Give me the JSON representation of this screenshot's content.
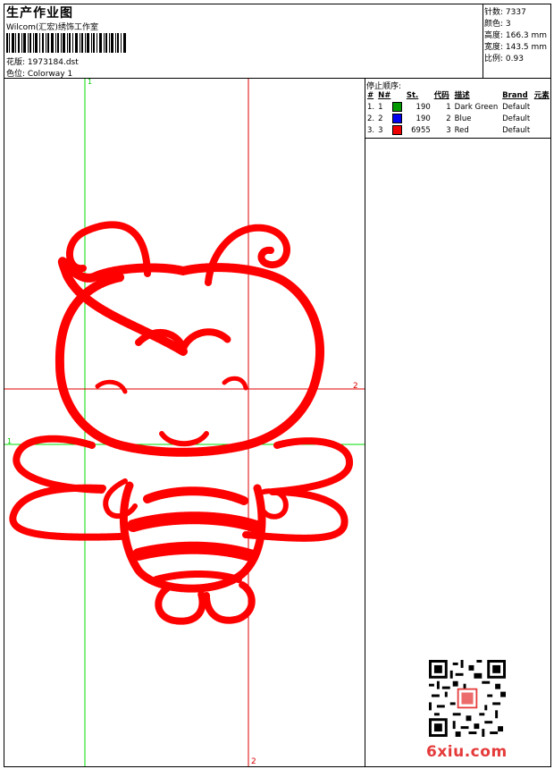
{
  "header": {
    "title": "生产作业图",
    "company": "Wilcom(汇宏)绣饰工作室",
    "design_label": "花版: 1973184.dst",
    "colorway_label": "色位: Colorway 1"
  },
  "stats": [
    {
      "label": "针数: 7337"
    },
    {
      "label": "颜色: 3"
    },
    {
      "label": "高度: 166.3 mm"
    },
    {
      "label": "宽度: 143.5 mm"
    },
    {
      "label": "比例: 0.93"
    }
  ],
  "stop_sequence": {
    "title": "停止顺序:",
    "headers": [
      "#",
      "N#",
      "St.",
      "代码",
      "描述",
      "Brand",
      "元素"
    ],
    "rows": [
      {
        "index": "1.",
        "n": "1",
        "stitches": "190",
        "code": "1",
        "desc": "Dark Green",
        "brand": "Default",
        "color": "#009900"
      },
      {
        "index": "2.",
        "n": "2",
        "stitches": "190",
        "code": "2",
        "desc": "Blue",
        "brand": "Default",
        "color": "#0000ee"
      },
      {
        "index": "3.",
        "n": "3",
        "stitches": "6955",
        "code": "3",
        "desc": "Red",
        "brand": "Default",
        "color": "#ee0000"
      }
    ]
  },
  "guides": {
    "v1": "1",
    "v2": "2",
    "h1": "1",
    "h2": "2",
    "v2_bottom": "2",
    "green": "#00dd00",
    "red": "#dd0000"
  },
  "embroidery_color": "#ff0000",
  "watermark": "6xiu.com"
}
